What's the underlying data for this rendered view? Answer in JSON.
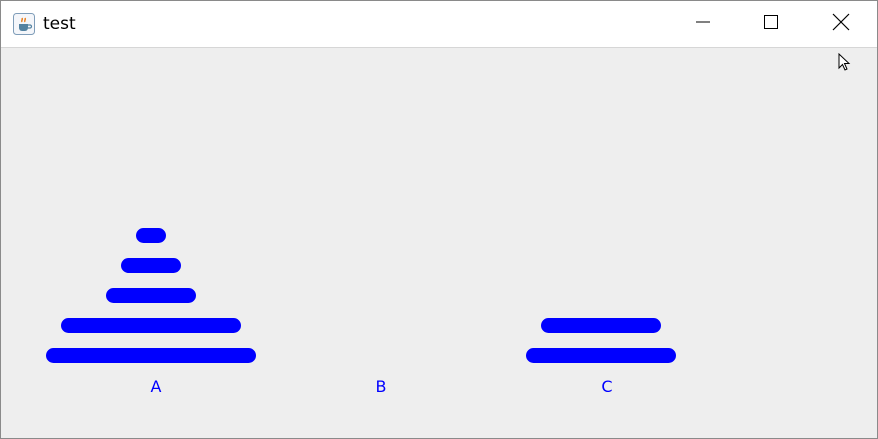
{
  "window": {
    "title": "test",
    "app_icon": "java-coffee-cup-icon",
    "controls": [
      "minimize-icon",
      "maximize-icon",
      "close-icon"
    ]
  },
  "hanoi": {
    "disk_color": "#0000ff",
    "label_color": "#0000ff",
    "pegs": [
      {
        "label": "A",
        "disks": 5
      },
      {
        "label": "B",
        "disks": 0
      },
      {
        "label": "C",
        "disks": 2
      }
    ]
  },
  "colors": {
    "background": "#eeeeee",
    "titlebar": "#ffffff"
  }
}
